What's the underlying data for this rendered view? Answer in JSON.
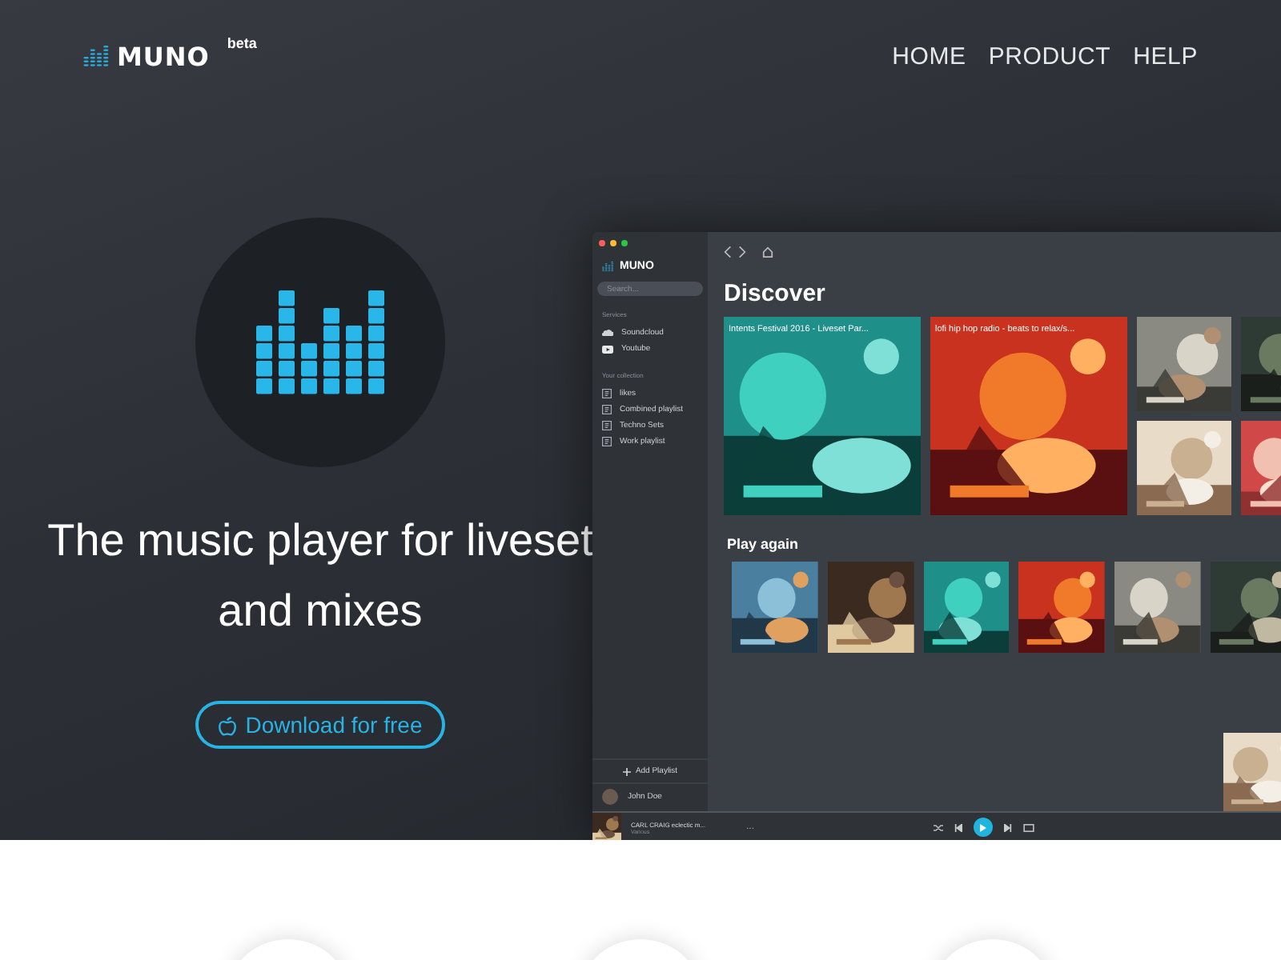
{
  "header": {
    "logo": "MUNO",
    "badge": "beta",
    "nav": [
      {
        "label": "HOME"
      },
      {
        "label": "PRODUCT"
      },
      {
        "label": "HELP"
      }
    ]
  },
  "hero": {
    "title_lines": [
      "The music player for liveset",
      "and mixes"
    ],
    "button": "Download for free"
  },
  "app": {
    "logo": "MUNO",
    "search": {
      "placeholder": "Search..."
    },
    "sections": [
      {
        "heading": "Services",
        "items": [
          {
            "label": "Soundcloud",
            "kind": "cloud"
          },
          {
            "label": "Youtube",
            "kind": "video"
          }
        ]
      },
      {
        "heading": "Your collection",
        "items": [
          {
            "label": "likes",
            "kind": "playlist"
          },
          {
            "label": "Combined playlist",
            "kind": "playlist"
          },
          {
            "label": "Techno Sets",
            "kind": "playlist"
          },
          {
            "label": "Work playlist",
            "kind": "playlist"
          }
        ]
      }
    ],
    "add_playlist": "Add Playlist",
    "user": "John Doe",
    "discover": {
      "title": "Discover",
      "featured": [
        {
          "title": "Intents Festival 2016 - Liveset Par..."
        },
        {
          "title": "lofi hip hop radio - beats to relax/s..."
        }
      ]
    },
    "play_again": {
      "title": "Play again"
    },
    "player": {
      "track": "CARL CRAIG eclectic m...",
      "artist": "Various",
      "more": "..."
    }
  }
}
